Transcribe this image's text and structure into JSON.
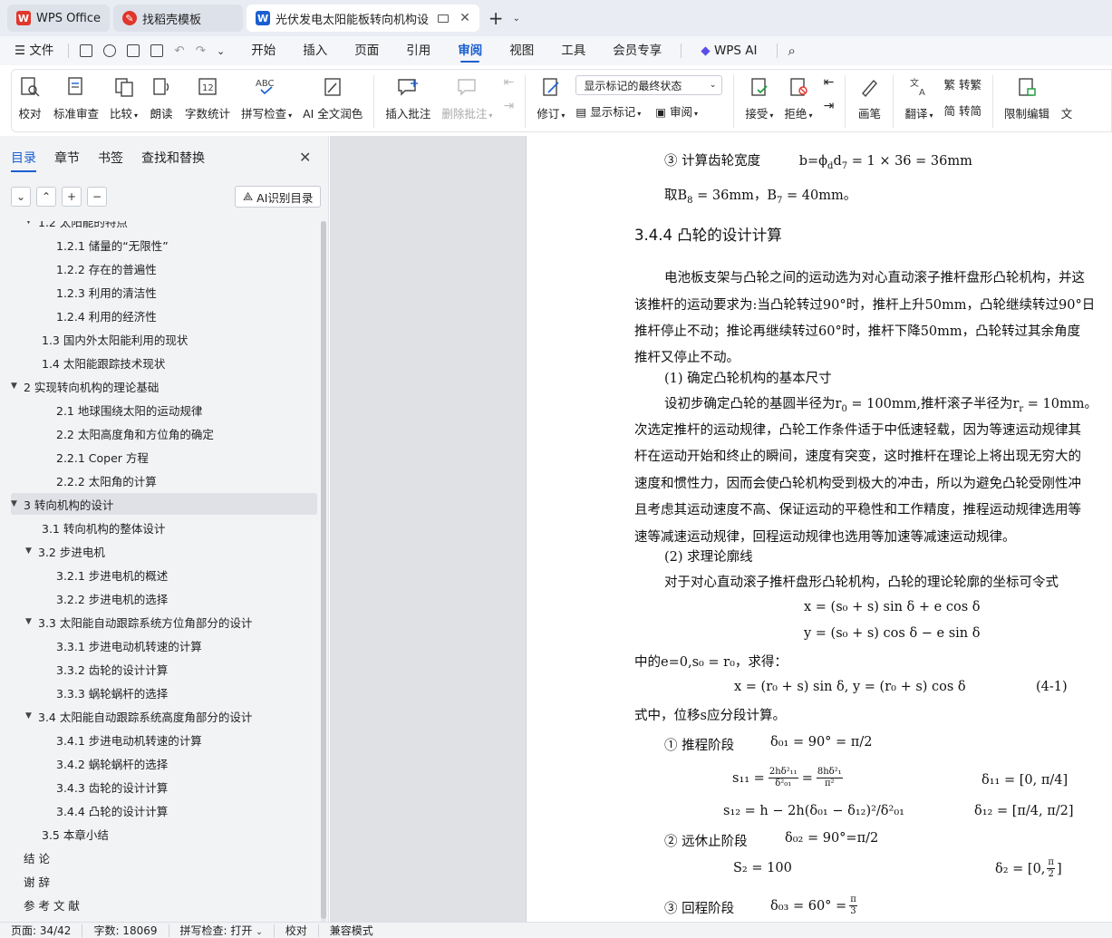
{
  "tabs": [
    {
      "label": "WPS Office",
      "logo": "wps-logo",
      "color": "#e0362c"
    },
    {
      "label": "找稻壳模板",
      "logo": "docer-logo",
      "color": "#e0362c"
    },
    {
      "label": "光伏发电太阳能板转向机构设",
      "logo": "writer-logo",
      "color": "#1a5fd1"
    }
  ],
  "menu": {
    "file": "文件",
    "items": [
      "开始",
      "插入",
      "页面",
      "引用",
      "审阅",
      "视图",
      "工具",
      "会员专享"
    ],
    "active": "审阅",
    "wps_ai": "WPS AI"
  },
  "ribbon": {
    "proofread": "校对",
    "std_review": "标准审查",
    "compare": "比较",
    "read_aloud": "朗读",
    "word_count": "字数统计",
    "spell_check": "拼写检查",
    "ai_polish": "AI 全文润色",
    "insert_comment": "插入批注",
    "delete_comment": "删除批注",
    "revise": "修订",
    "markup_select": "显示标记的最终状态",
    "show_markup": "显示标记",
    "review": "审阅",
    "accept": "接受",
    "reject": "拒绝",
    "pen": "画笔",
    "translate": "翻译",
    "to_traditional": "转繁",
    "to_simplified": "转简",
    "restrict_edit": "限制编辑",
    "cut_text": "文"
  },
  "left_panel": {
    "tabs": [
      "目录",
      "章节",
      "书签",
      "查找和替换"
    ],
    "ai_toc": "AI识别目录",
    "toc": [
      {
        "text": "1.2  太阳能的特点",
        "level": 2,
        "caret": "▼"
      },
      {
        "text": "1.2.1  储量的“无限性”",
        "level": 3
      },
      {
        "text": "1.2.2  存在的普遍性",
        "level": 3
      },
      {
        "text": "1.2.3  利用的清洁性",
        "level": 3
      },
      {
        "text": "1.2.4  利用的经济性",
        "level": 3
      },
      {
        "text": "1.3  国内外太阳能利用的现状",
        "level": 2
      },
      {
        "text": "1.4  太阳能跟踪技术现状",
        "level": 2
      },
      {
        "text": "2  实现转向机构的理论基础",
        "level": 1,
        "caret": "▼"
      },
      {
        "text": "2.1  地球围绕太阳的运动规律",
        "level": 3
      },
      {
        "text": "2.2  太阳高度角和方位角的确定",
        "level": 3
      },
      {
        "text": "2.2.1 Coper 方程",
        "level": 3
      },
      {
        "text": "2.2.2  太阳角的计算",
        "level": 3
      },
      {
        "text": "3  转向机构的设计",
        "level": 1,
        "caret": "▼",
        "selected": true
      },
      {
        "text": "3.1  转向机构的整体设计",
        "level": 2
      },
      {
        "text": "3.2  步进电机",
        "level": 2,
        "caret": "▼"
      },
      {
        "text": "3.2.1  步进电机的概述",
        "level": 3
      },
      {
        "text": "3.2.2 步进电机的选择",
        "level": 3
      },
      {
        "text": "3.3  太阳能自动跟踪系统方位角部分的设计",
        "level": 2,
        "caret": "▼"
      },
      {
        "text": "3.3.1 步进电动机转速的计算",
        "level": 3
      },
      {
        "text": "3.3.2  齿轮的设计计算",
        "level": 3
      },
      {
        "text": "3.3.3  蜗轮蜗杆的选择",
        "level": 3
      },
      {
        "text": "3.4  太阳能自动跟踪系统高度角部分的设计",
        "level": 2,
        "caret": "▼"
      },
      {
        "text": "3.4.1  步进电动机转速的计算",
        "level": 3
      },
      {
        "text": "3.4.2  蜗轮蜗杆的选择",
        "level": 3
      },
      {
        "text": "3.4.3  齿轮的设计计算",
        "level": 3
      },
      {
        "text": "3.4.4  凸轮的设计计算",
        "level": 3
      },
      {
        "text": "3.5  本章小结",
        "level": 2
      },
      {
        "text": "结      论",
        "level": 1
      },
      {
        "text": "谢      辞",
        "level": 1
      },
      {
        "text": "参 考 文 献",
        "level": 1
      }
    ]
  },
  "document": {
    "l1_label": "③ 计算齿轮宽度",
    "l1_eq": "b=ϕ",
    "l1_eq2": "d",
    "l1_eq3": "d",
    "l1_eq4": "7",
    "l1_eq5": " = 1 × 36 = 36mm",
    "l2_a": "取B",
    "l2_b": "8",
    "l2_c": " = 36mm，B",
    "l2_d": "7",
    "l2_e": " = 40mm。",
    "heading": "3.4.4  凸轮的设计计算",
    "p1": "电池板支架与凸轮之间的运动选为对心直动滚子推杆盘形凸轮机构，并这",
    "p2": "该推杆的运动要求为:当凸轮转过90°时，推杆上升50mm，凸轮继续转过90°日",
    "p3": "推杆停止不动；推论再继续转过60°时，推杆下降50mm，凸轮转过其余角度",
    "p4": "推杆又停止不动。",
    "s1": "(1)  确定凸轮机构的基本尺寸",
    "p5a": "设初步确定凸轮的基圆半径为r",
    "p5b": "0",
    "p5c": " = 100mm,推杆滚子半径为r",
    "p5d": "r",
    "p5e": " = 10mm。",
    "p6": "次选定推杆的运动规律，凸轮工作条件适于中低速轻载，因为等速运动规律其",
    "p7": "杆在运动开始和终止的瞬间，速度有突变，这时推杆在理论上将出现无穷大的",
    "p8": "速度和惯性力，因而会使凸轮机构受到极大的冲击，所以为避免凸轮受刚性冲",
    "p9": "且考虑其运动速度不高、保证运动的平稳性和工作精度，推程运动规律选用等",
    "p10": "速等减速运动规律，回程运动规律也选用等加速等减速运动规律。",
    "s2": "(2)  求理论廓线",
    "p11": "对于对心直动滚子推杆盘形凸轮机构，凸轮的理论轮廓的坐标可令式",
    "eq1": "x = (s₀ + s) sin δ + e cos δ",
    "eq2": "y = (s₀ + s) cos δ −  e sin δ",
    "p12": "中的e=0,s₀ = r₀，求得：",
    "eq3": "x = (r₀ + s) sin δ,   y = (r₀ + s) cos δ",
    "eq3_no": "(4-1)",
    "p13": "式中，位移s应分段计算。",
    "st1_label": "① 推程阶段",
    "st1_eq": "δ₀₁ = 90° = π/2",
    "s11_lhs": "s₁₁ =",
    "s11_f1n": "2hδ²₁₁",
    "s11_f1d": "δ²₀₁",
    "s11_eq": "=",
    "s11_f2n": "8hδ²₁",
    "s11_f2d": "π²",
    "s11_range": "δ₁₁ = [0, π/4]",
    "s12": "s₁₂ = h − 2h(δ₀₁ − δ₁₂)²/δ²₀₁",
    "s12_range": "δ₁₂ = [π/4, π/2]",
    "st2_label": "② 远休止阶段",
    "st2_eq": "δ₀₂ = 90°=π/2",
    "s2_eq": "S₂ = 100",
    "s2_range_a": "δ₂ = [0,",
    "s2_range_n": "π",
    "s2_range_d": "2",
    "s2_range_b": "]",
    "st3_label": "③ 回程阶段",
    "st3_eq": "δ₀₃ = 60° =",
    "st3_n": "π",
    "st3_d": "3"
  },
  "status": {
    "page": "页面: 34/42",
    "words": "字数: 18069",
    "spell": "拼写检查: 打开",
    "proof": "校对",
    "compat": "兼容模式"
  }
}
